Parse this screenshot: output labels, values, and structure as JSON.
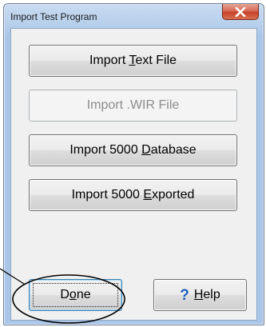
{
  "window": {
    "title": "Import Test Program",
    "close_icon": "close-icon"
  },
  "buttons": {
    "import_text_file": {
      "pre": "Import ",
      "accel": "T",
      "post": "ext File",
      "enabled": true
    },
    "import_wir_file": {
      "label": "Import .WIR File",
      "enabled": false
    },
    "import_5000_database": {
      "pre": "Import 5000 ",
      "accel": "D",
      "post": "atabase",
      "enabled": true
    },
    "import_5000_exported": {
      "pre": "Import 5000 ",
      "accel": "E",
      "post": "xported",
      "enabled": true
    },
    "done": {
      "pre": "D",
      "accel": "o",
      "post": "ne",
      "focused": true
    },
    "help": {
      "icon_glyph": "?",
      "icon": "help-question-icon",
      "accel": "H",
      "post": "elp"
    }
  },
  "annotation": {
    "shape": "ellipse-callout",
    "color": "#000000",
    "target": "done-button"
  }
}
